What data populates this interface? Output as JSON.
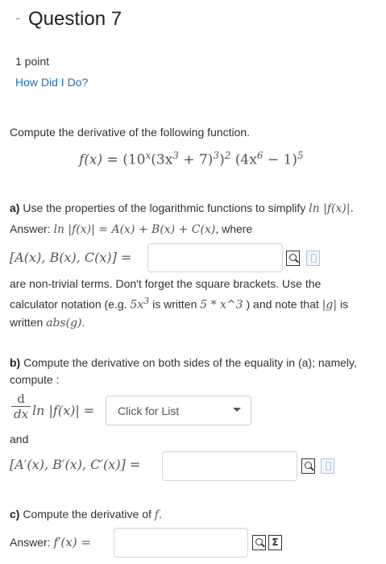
{
  "header": {
    "dash": "-",
    "title": "Question 7"
  },
  "meta": {
    "points": "1 point",
    "how_did_i_do": "How Did I Do?"
  },
  "prompt": "Compute the derivative of the following function.",
  "formula": {
    "lhs": "f(x) = ",
    "part1": "(10",
    "part1_sup": "x",
    "part2": "(3x",
    "part2_sup": "3",
    "part3": " + 7)",
    "part3_sup": "3",
    "part4": ")",
    "part4_sup": "2",
    "part5": " (4x",
    "part5_sup": "6",
    "part6": " − 1)",
    "part6_sup": "5"
  },
  "part_a": {
    "label": "a)",
    "text": "Use the properties of the logarithmic functions to simplify ",
    "text_math": "ln |f(x)|.",
    "answer_label": "Answer: ",
    "answer_math": "ln |f(x)| = A(x) + B(x) + C(x)",
    "answer_suffix": ", where",
    "input_label": "[A(x), B(x), C(x)] =",
    "note1": "are non-trivial terms. Don't forget the square brackets. Use the",
    "note2_a": "calculator notation (e.g. ",
    "note2_math1": "5x",
    "note2_sup": "3",
    "note2_b": " is written ",
    "note2_math2": "5 * x^3",
    "note2_c": " ) and note that ",
    "note2_math3": "|g|",
    "note2_d": " is",
    "note3_a": "written ",
    "note3_math": "abs(g)",
    "note3_b": "."
  },
  "part_b": {
    "label": "b)",
    "text1": "Compute the derivative on both sides of the equality in (a); namely,",
    "text2": "compute :",
    "d_num": "d",
    "d_den": "dx",
    "deriv_math": "ln |f(x)| =",
    "select_value": "Click for List",
    "and_label": "and",
    "input_label": "[A′(x), B′(x), C′(x)] ="
  },
  "part_c": {
    "label": "c)",
    "text": "Compute the derivative of ",
    "text_math": "f",
    "text_end": ".",
    "answer_label": "Answer: ",
    "answer_math": "f′(x) ="
  }
}
